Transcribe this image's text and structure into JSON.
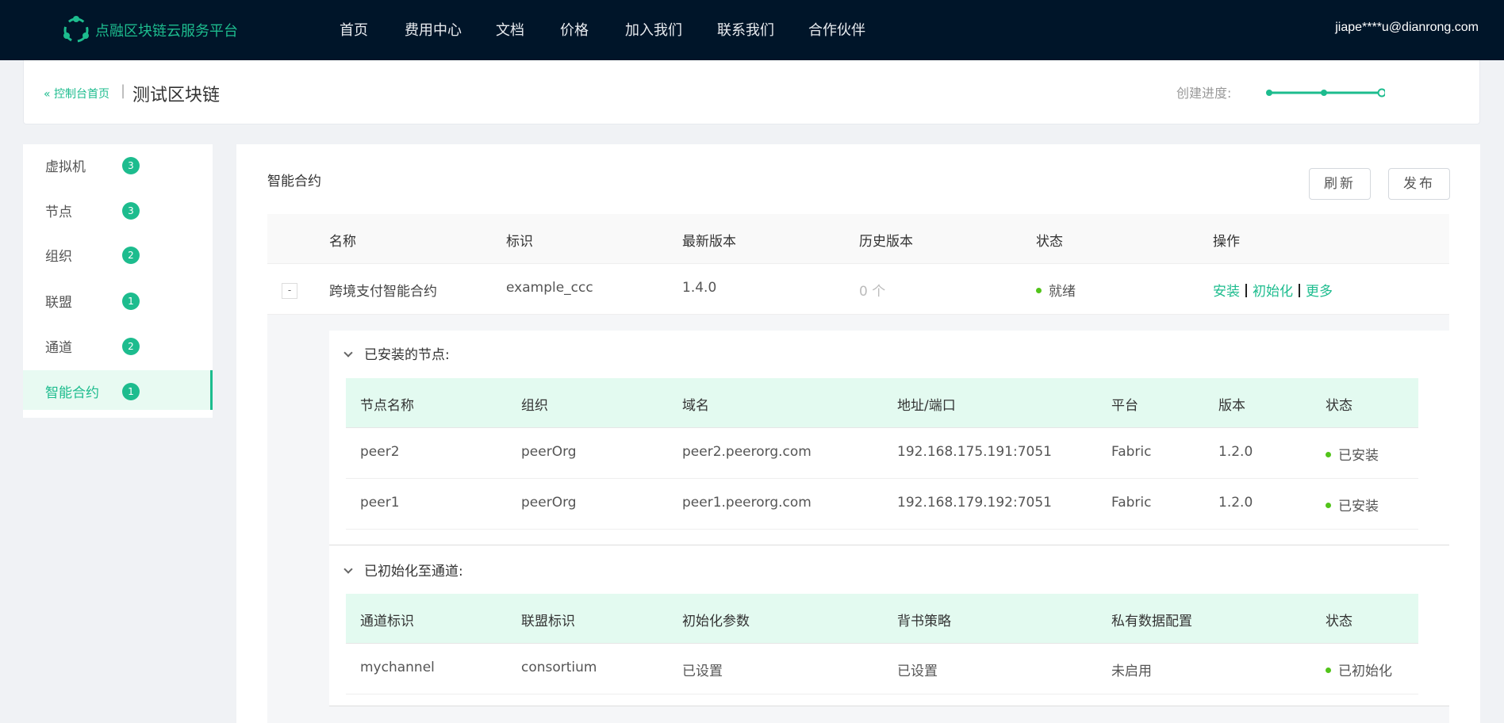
{
  "nav": {
    "brand": "点融区块链云服务平台",
    "items": [
      "首页",
      "费用中心",
      "文档",
      "价格",
      "加入我们",
      "联系我们",
      "合作伙伴"
    ],
    "user": "jiape****u@dianrong.com"
  },
  "breadcrumb": {
    "back": "控制台首页",
    "separator": "|",
    "title": "测试区块链",
    "progress_label": "创建进度:",
    "progress_steps_completed": 2,
    "progress_steps_total": 3
  },
  "sidebar": {
    "items": [
      {
        "label": "虚拟机",
        "count": "3"
      },
      {
        "label": "节点",
        "count": "3"
      },
      {
        "label": "组织",
        "count": "2"
      },
      {
        "label": "联盟",
        "count": "1"
      },
      {
        "label": "通道",
        "count": "2"
      },
      {
        "label": "智能合约",
        "count": "1",
        "active": true
      }
    ]
  },
  "main": {
    "title": "智能合约",
    "refresh_label": "刷新",
    "publish_label": "发布",
    "columns": [
      "名称",
      "标识",
      "最新版本",
      "历史版本",
      "状态",
      "操作"
    ],
    "row": {
      "collapse": "-",
      "name": "跨境支付智能合约",
      "id": "example_ccc",
      "latest": "1.4.0",
      "history": "0 个",
      "status": "就绪",
      "actions": [
        "安装",
        "初始化",
        "更多"
      ]
    }
  },
  "installed": {
    "heading": "已安装的节点:",
    "columns": [
      "节点名称",
      "组织",
      "域名",
      "地址/端口",
      "平台",
      "版本",
      "状态"
    ],
    "rows": [
      [
        "peer2",
        "peerOrg",
        "peer2.peerorg.com",
        "192.168.175.191:7051",
        "Fabric",
        "1.2.0",
        "已安装"
      ],
      [
        "peer1",
        "peerOrg",
        "peer1.peerorg.com",
        "192.168.179.192:7051",
        "Fabric",
        "1.2.0",
        "已安装"
      ]
    ]
  },
  "channels": {
    "heading": "已初始化至通道:",
    "columns": [
      "通道标识",
      "联盟标识",
      "初始化参数",
      "背书策略",
      "私有数据配置",
      "状态"
    ],
    "rows": [
      [
        "mychannel",
        "consortium",
        "已设置",
        "已设置",
        "未启用",
        "已初始化"
      ]
    ]
  },
  "colors": {
    "accent": "#1dbc8e",
    "nav_bg": "#001529",
    "status_dot": "#52c41a",
    "table_head_sub": "#e3faf0"
  }
}
